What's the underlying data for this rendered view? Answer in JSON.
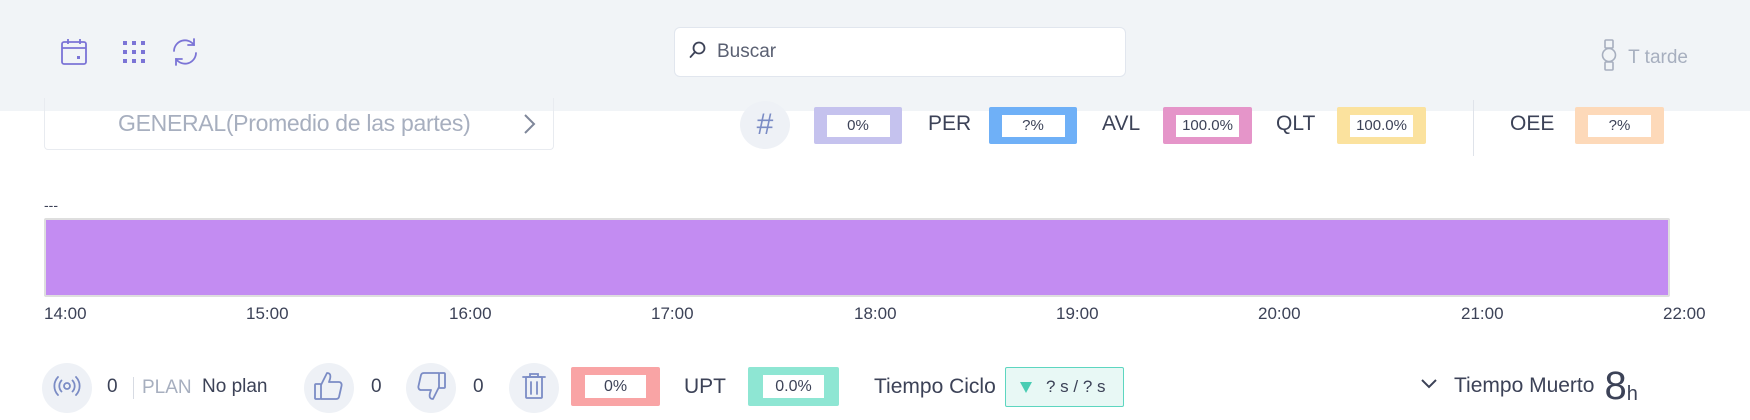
{
  "header": {
    "icons": [
      "calendar-icon",
      "grid-icon",
      "refresh-icon"
    ],
    "search_placeholder": "Buscar",
    "shift_label": "T tarde"
  },
  "selector": {
    "label": "GENERAL(Promedio de las partes)"
  },
  "metrics": [
    {
      "label": "",
      "value": "0%",
      "color": "#c5c2ee"
    },
    {
      "label": "PER",
      "value": "?%",
      "color": "#6fb0f7"
    },
    {
      "label": "AVL",
      "value": "100.0%",
      "color": "#e595c9"
    },
    {
      "label": "QLT",
      "value": "100.0%",
      "color": "#fbe29e"
    },
    {
      "label": "OEE",
      "value": "?%",
      "color": "#fdd9b9"
    }
  ],
  "timeline": {
    "label": "---",
    "bar_color": "#c38cf2",
    "ticks": [
      "14:00",
      "15:00",
      "16:00",
      "17:00",
      "18:00",
      "19:00",
      "20:00",
      "21:00",
      "22:00"
    ]
  },
  "bottom": {
    "count": "0",
    "plan_label": "PLAN",
    "plan_value": "No plan",
    "good_count": "0",
    "bad_count": "0",
    "scrap_value": "0%",
    "scrap_color": "#f9a4a5",
    "upt_label": "UPT",
    "upt_value": "0.0%",
    "upt_color": "#8ee6d3",
    "cycle_label": "Tiempo Ciclo",
    "cycle_value": "? s / ? s",
    "dead_label": "Tiempo Muerto",
    "dead_value": "8",
    "dead_unit": "h"
  }
}
